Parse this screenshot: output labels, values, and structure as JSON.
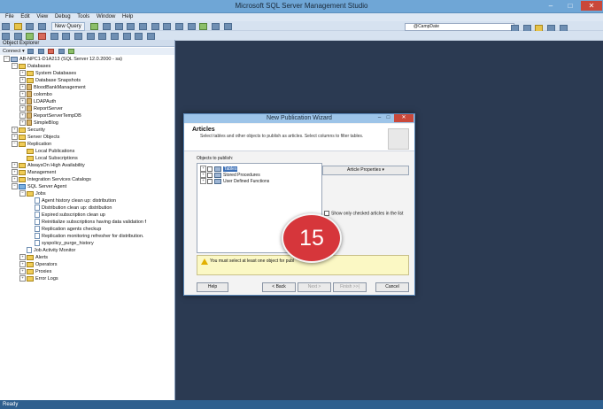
{
  "window": {
    "title": "Microsoft SQL Server Management Studio",
    "minimize": "–",
    "maximize": "□",
    "close": "✕"
  },
  "menu": [
    "File",
    "Edit",
    "View",
    "Debug",
    "Tools",
    "Window",
    "Help"
  ],
  "toolbar": {
    "new_query_label": "New Query",
    "database_combo_value": "@CampDate"
  },
  "object_explorer": {
    "title": "Object Explorer",
    "connect_label": "Connect ▾",
    "tree": [
      {
        "label": "AB-NPC1-D1A213 (SQL Server 12.0.2000 - sa)",
        "level": 0,
        "expander": "−",
        "icon": "server"
      },
      {
        "label": "Databases",
        "level": 1,
        "expander": "−",
        "icon": "folder"
      },
      {
        "label": "System Databases",
        "level": 2,
        "expander": "+",
        "icon": "folder"
      },
      {
        "label": "Database Snapshots",
        "level": 2,
        "expander": "+",
        "icon": "folder"
      },
      {
        "label": "BloodBankManagement",
        "level": 2,
        "expander": "+",
        "icon": "database"
      },
      {
        "label": "colombo",
        "level": 2,
        "expander": "+",
        "icon": "database"
      },
      {
        "label": "LDAPAuth",
        "level": 2,
        "expander": "+",
        "icon": "database"
      },
      {
        "label": "ReportServer",
        "level": 2,
        "expander": "+",
        "icon": "database"
      },
      {
        "label": "ReportServerTempDB",
        "level": 2,
        "expander": "+",
        "icon": "database"
      },
      {
        "label": "SimpleBlog",
        "level": 2,
        "expander": "+",
        "icon": "database"
      },
      {
        "label": "Security",
        "level": 1,
        "expander": "+",
        "icon": "folder"
      },
      {
        "label": "Server Objects",
        "level": 1,
        "expander": "+",
        "icon": "folder"
      },
      {
        "label": "Replication",
        "level": 1,
        "expander": "−",
        "icon": "folder"
      },
      {
        "label": "Local Publications",
        "level": 2,
        "expander": "",
        "icon": "folder"
      },
      {
        "label": "Local Subscriptions",
        "level": 2,
        "expander": "",
        "icon": "folder"
      },
      {
        "label": "AlwaysOn High Availability",
        "level": 1,
        "expander": "+",
        "icon": "folder"
      },
      {
        "label": "Management",
        "level": 1,
        "expander": "+",
        "icon": "folder"
      },
      {
        "label": "Integration Services Catalogs",
        "level": 1,
        "expander": "+",
        "icon": "folder"
      },
      {
        "label": "SQL Server Agent",
        "level": 1,
        "expander": "−",
        "icon": "agent"
      },
      {
        "label": "Jobs",
        "level": 2,
        "expander": "−",
        "icon": "folder"
      },
      {
        "label": "Agent history clean up: distribution",
        "level": 3,
        "expander": "",
        "icon": "job"
      },
      {
        "label": "Distribution clean up: distribution",
        "level": 3,
        "expander": "",
        "icon": "job"
      },
      {
        "label": "Expired subscription clean up",
        "level": 3,
        "expander": "",
        "icon": "job"
      },
      {
        "label": "Reinitialize subscriptions having data validation f",
        "level": 3,
        "expander": "",
        "icon": "job"
      },
      {
        "label": "Replication agents checkup",
        "level": 3,
        "expander": "",
        "icon": "job"
      },
      {
        "label": "Replication monitoring refresher for distribution.",
        "level": 3,
        "expander": "",
        "icon": "job"
      },
      {
        "label": "syspolicy_purge_history",
        "level": 3,
        "expander": "",
        "icon": "job"
      },
      {
        "label": "Job Activity Monitor",
        "level": 2,
        "expander": "",
        "icon": "job"
      },
      {
        "label": "Alerts",
        "level": 2,
        "expander": "+",
        "icon": "folder"
      },
      {
        "label": "Operators",
        "level": 2,
        "expander": "+",
        "icon": "folder"
      },
      {
        "label": "Proxies",
        "level": 2,
        "expander": "+",
        "icon": "folder"
      },
      {
        "label": "Error Logs",
        "level": 2,
        "expander": "+",
        "icon": "folder"
      }
    ]
  },
  "status_bar": {
    "text": "Ready"
  },
  "wizard": {
    "title": "New Publication Wizard",
    "header_title": "Articles",
    "header_description": "Select tables and other objects to publish as articles. Select columns to filter tables.",
    "objects_label": "Objects to publish:",
    "objects": [
      {
        "label": "Tables",
        "selected": true
      },
      {
        "label": "Stored Procedures",
        "selected": false
      },
      {
        "label": "User Defined Functions",
        "selected": false
      }
    ],
    "article_properties_label": "Article Properties   ▾",
    "show_only_checked_label": "Show only checked articles in the list",
    "warning_text": "You must select at least one object for publ",
    "buttons": {
      "help": "Help",
      "back": "< Back",
      "next": "Next >",
      "finish": "Finish >>|",
      "cancel": "Cancel"
    }
  },
  "badge": {
    "number": "15",
    "color": "#d6363b"
  },
  "colors": {
    "titlebar": "#6fa6d6",
    "workspace": "#2b3a52",
    "statusbar": "#2e5f8e"
  }
}
